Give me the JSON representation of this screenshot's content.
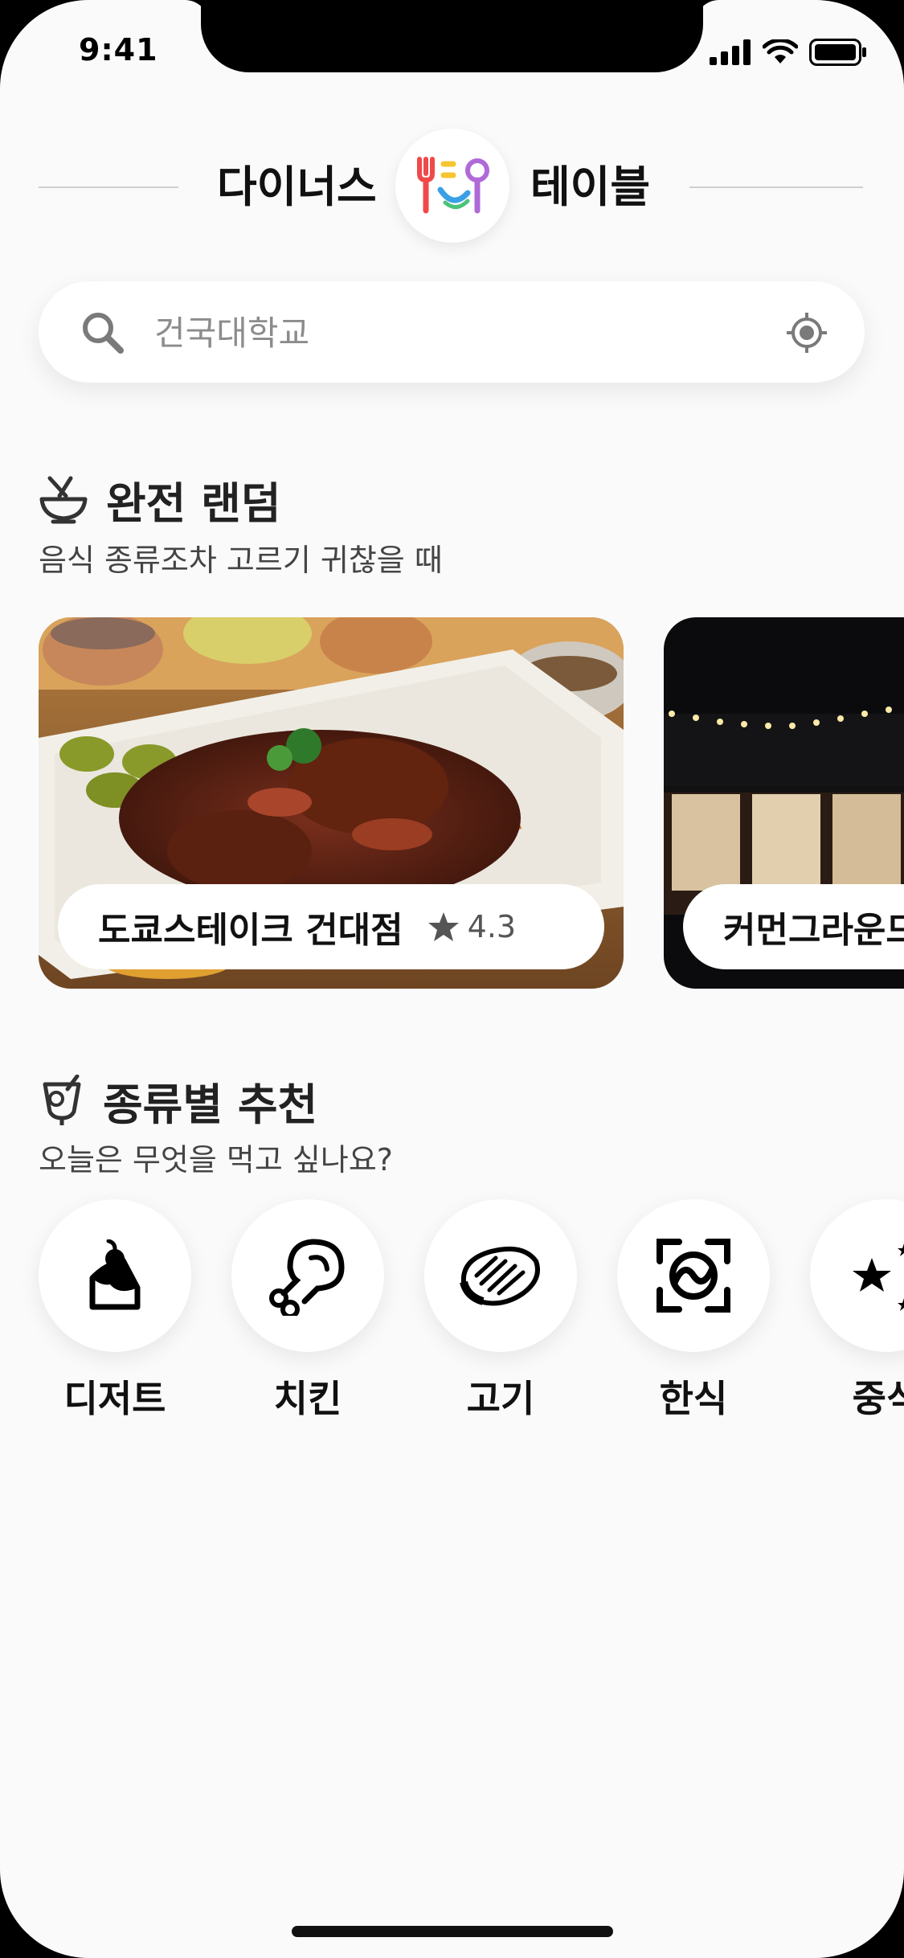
{
  "status_bar": {
    "time": "9:41"
  },
  "header": {
    "brand_left": "다이너스",
    "brand_right": "테이블",
    "logo_icon": "fork-spoon-smile-logo"
  },
  "search": {
    "placeholder": "건국대학교",
    "search_icon": "search-icon",
    "locate_icon": "location-target-icon"
  },
  "random_section": {
    "icon": "bowl-icon",
    "title": "완전 랜덤",
    "subtitle": "음식 종류조차 고르기 귀찮을 때",
    "cards": [
      {
        "name": "도쿄스테이크 건대점",
        "rating": "4.3"
      },
      {
        "name": "커먼그라운드"
      }
    ]
  },
  "category_section": {
    "icon": "drink-icon",
    "title": "종류별 추천",
    "subtitle": "오늘은 무엇을 먹고 싶나요?",
    "categories": [
      {
        "label": "디저트",
        "icon": "cake-icon"
      },
      {
        "label": "치킨",
        "icon": "drumstick-icon"
      },
      {
        "label": "고기",
        "icon": "steak-icon"
      },
      {
        "label": "한식",
        "icon": "korean-food-icon"
      },
      {
        "label": "중식",
        "icon": "chinese-food-icon"
      }
    ]
  },
  "colors": {
    "background": "#fafafa",
    "text": "#111111",
    "logo_red": "#f0494a",
    "logo_yellow": "#f7c531",
    "logo_blue": "#3aa0e6",
    "logo_purple": "#b06ad8"
  }
}
